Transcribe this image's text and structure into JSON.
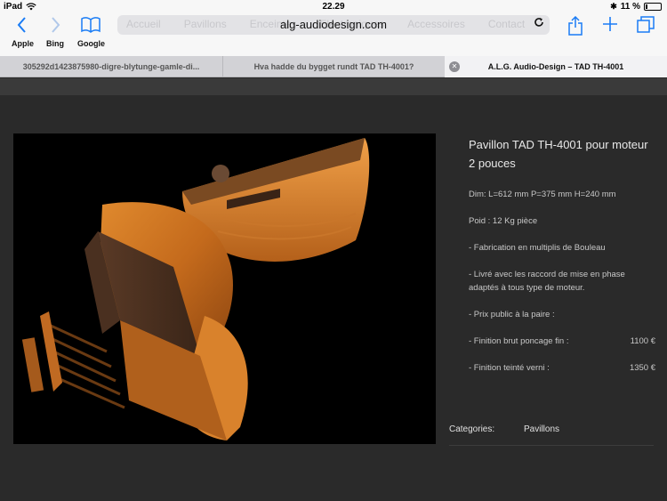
{
  "status_bar": {
    "device": "iPad",
    "time": "22.29",
    "battery_percent": "11 %",
    "battery_level": 0.11
  },
  "toolbar": {
    "back_icon": "chevron-left-icon",
    "forward_icon": "chevron-right-icon",
    "bookmarks_icon": "book-icon",
    "url": "alg-audiodesign.com",
    "reload_icon": "reload-icon",
    "share_icon": "share-icon",
    "new_tab_icon": "plus-icon",
    "tabs_icon": "tabs-icon",
    "accent_color": "#1a7cf5"
  },
  "ghost_menu": [
    "Accueil",
    "Pavillons",
    "Enceintes",
    "Electroniques",
    "Accessoires",
    "Contact"
  ],
  "favorites": [
    "Apple",
    "Bing",
    "Google"
  ],
  "tabs": [
    {
      "label": "305292d1423875980-digre-blytunge-gamle-di..."
    },
    {
      "label": "Hva hadde du bygget rundt TAD TH-4001?"
    },
    {
      "label": "A.L.G. Audio-Design – TAD TH-4001"
    }
  ],
  "product": {
    "title": "Pavillon TAD TH-4001 pour moteur 2 pouces",
    "dimensions": "Dim: L=612 mm   P=375 mm   H=240 mm",
    "weight": "Poid : 12 Kg pièce",
    "fabrication": "- Fabrication en multiplis de Bouleau",
    "delivery": "- Livré avec les raccord de mise en phase adaptés à tous type de moteur.",
    "price_pair": "- Prix public à la paire :",
    "finish_raw_label": "- Finition brut poncage fin :",
    "finish_raw_price": "1100 €",
    "finish_tinted_label": "- Finition teinté verni :",
    "finish_tinted_price": "1350 €"
  },
  "categories": {
    "label": "Categories:",
    "value": "Pavillons"
  }
}
